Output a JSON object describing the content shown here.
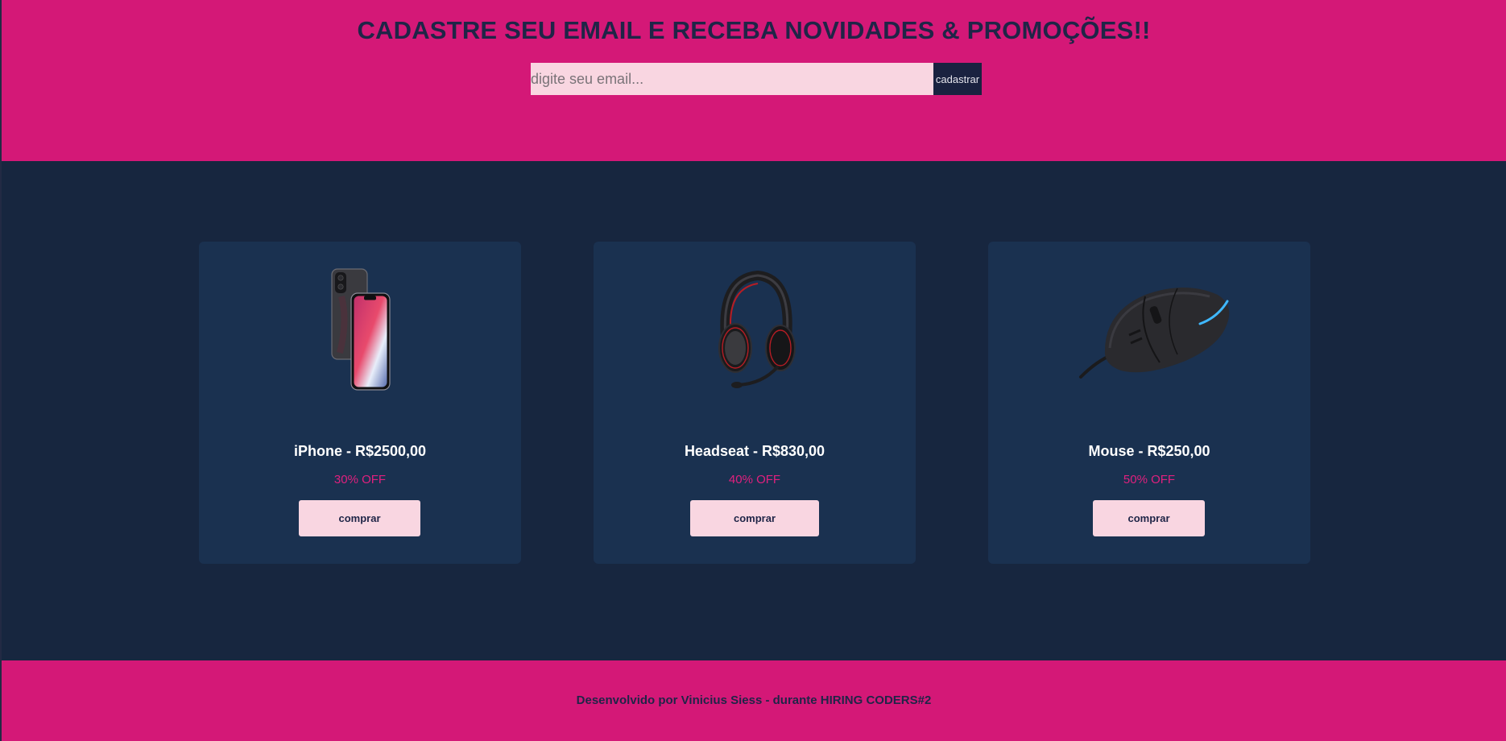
{
  "newsletter": {
    "title": "CADASTRE SEU EMAIL E RECEBA NOVIDADES & PROMOÇÕES!!",
    "email_placeholder": "digite seu email...",
    "email_value": "",
    "submit_label": "cadastrar"
  },
  "products": [
    {
      "name": "iPhone - R$2500,00",
      "discount": "30% OFF",
      "buy_label": "comprar",
      "image_icon": "iphone-image"
    },
    {
      "name": "Headseat - R$830,00",
      "discount": "40% OFF",
      "buy_label": "comprar",
      "image_icon": "headset-image"
    },
    {
      "name": "Mouse - R$250,00",
      "discount": "50% OFF",
      "buy_label": "comprar",
      "image_icon": "mouse-image"
    }
  ],
  "footer": {
    "credit": "Desenvolvido por Vinicius Siess - durante HIRING CODERS#2"
  },
  "colors": {
    "brand_pink": "#d41877",
    "navy": "#17263f",
    "card": "#1a3150",
    "discount": "#e0207e",
    "button_bg": "#f9d6e1"
  }
}
